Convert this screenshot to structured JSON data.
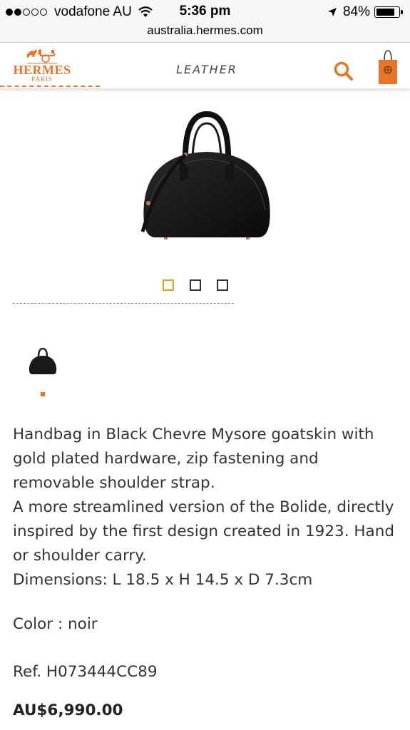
{
  "status_bar": {
    "carrier": "vodafone AU",
    "time": "5:36 pm",
    "battery": "84%",
    "battery_level": 0.84,
    "signal_bars_filled": 2,
    "signal_bars_total": 5,
    "icons": [
      "wifi-icon",
      "location-arrow-icon",
      "battery-icon"
    ]
  },
  "browser": {
    "url": "australia.hermes.com"
  },
  "header": {
    "logo_main": "HERMES",
    "logo_sub": "PARIS",
    "section_title": "LEATHER",
    "icons": [
      "hermes-carriage-logo",
      "search-icon",
      "shopping-bag-icon"
    ],
    "accent_color": "#e8742a"
  },
  "gallery": {
    "image": "black-handbag-image",
    "pager_count": 3,
    "active_index": 0,
    "active_color": "#e8a010"
  },
  "product": {
    "description_lines": [
      "Handbag in Black Chevre Mysore goatskin with gold plated hardware, zip fastening and removable shoulder strap.",
      "A more streamlined version of the Bolide, directly inspired by the first design created in 1923. Hand or shoulder carry.",
      "Dimensions: L 18.5 x H 14.5 x D 7.3cm"
    ],
    "color": "Color : noir",
    "ref": "Ref. H073444CC89",
    "price": "AU$6,990.00"
  }
}
